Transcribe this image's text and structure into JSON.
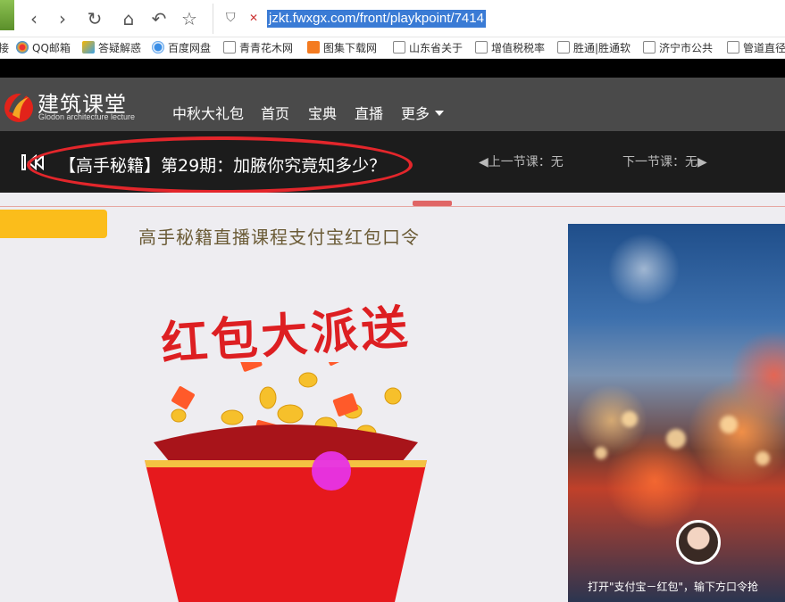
{
  "browser": {
    "url": "jzkt.fwxgx.com/front/playkpoint/7414",
    "bookmarks": [
      {
        "label": "接",
        "icon": "partial-icon"
      },
      {
        "label": "QQ邮箱",
        "icon": "qq-mail-icon"
      },
      {
        "label": "答疑解惑",
        "icon": "qa-icon"
      },
      {
        "label": "百度网盘",
        "icon": "baidu-pan-icon"
      },
      {
        "label": "青青花木网",
        "icon": "page-icon"
      },
      {
        "label": "图集下载网",
        "icon": "image-icon"
      },
      {
        "label": "山东省关于",
        "icon": "page-icon"
      },
      {
        "label": "增值税税率",
        "icon": "page-icon"
      },
      {
        "label": "胜通|胜通软",
        "icon": "page-icon"
      },
      {
        "label": "济宁市公共",
        "icon": "page-icon"
      },
      {
        "label": "管道直径",
        "icon": "page-icon"
      }
    ]
  },
  "site": {
    "logo_title": "建筑课堂",
    "logo_subtitle": "Glodon architecture lecture",
    "nav": [
      "中秋大礼包",
      "首页",
      "宝典",
      "直播",
      "更多"
    ]
  },
  "course": {
    "title": "【高手秘籍】第29期：加腋你究竟知多少？",
    "prev": "上一节课：无",
    "next": "下一节课：无"
  },
  "promo": {
    "heading": "高手秘籍直播课程支付宝红包口令",
    "banner_text": "红包大派送"
  },
  "video": {
    "caption": "打开\"支付宝－红包\"，输下方口令抢"
  },
  "colors": {
    "header_bg": "#4a4a4a",
    "course_bar_bg": "#1c1c1c",
    "ellipse_red": "#e3262b",
    "tag_yellow": "#fbbd1b",
    "hongbao_red": "#dd1f22",
    "cursor_magenta": "#e733e6"
  }
}
